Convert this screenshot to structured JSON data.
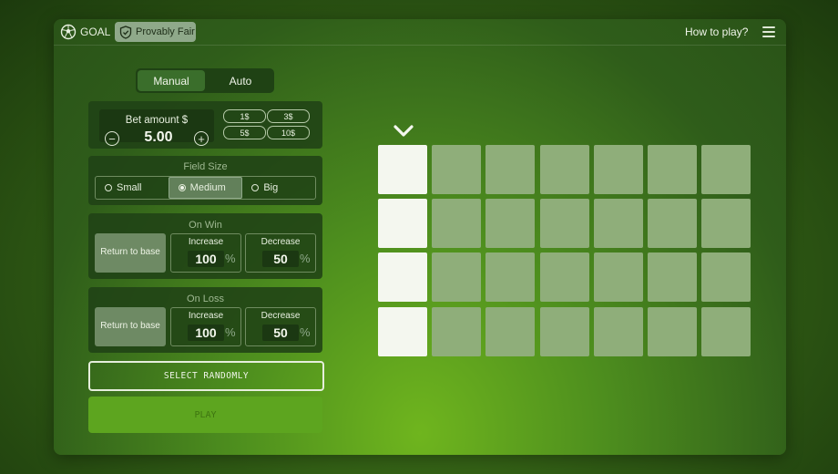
{
  "header": {
    "brand": "GOAL",
    "fair_label": "Provably Fair",
    "how_to_play": "How to play?"
  },
  "mode": {
    "tabs": [
      "Manual",
      "Auto"
    ],
    "active": "Manual"
  },
  "bet": {
    "label": "Bet amount $",
    "value": "5.00",
    "chips": [
      "1$",
      "3$",
      "5$",
      "10$"
    ]
  },
  "field_size": {
    "title": "Field Size",
    "options": [
      "Small",
      "Medium",
      "Big"
    ],
    "selected": "Medium"
  },
  "on_win": {
    "title": "On Win",
    "return_label": "Return to base",
    "increase_label": "Increase",
    "increase_value": "100",
    "decrease_label": "Decrease",
    "decrease_value": "50",
    "unit": "%"
  },
  "on_loss": {
    "title": "On Loss",
    "return_label": "Return to base",
    "increase_label": "Increase",
    "increase_value": "100",
    "decrease_label": "Decrease",
    "decrease_value": "50",
    "unit": "%"
  },
  "actions": {
    "select_randomly": "SELECT RANDOMLY",
    "play": "PLAY"
  },
  "board": {
    "rows": 4,
    "columns": 7,
    "active_column": 1
  },
  "colors": {
    "accent": "#5da51f",
    "cell_inactive": "#8fae7a",
    "cell_active": "#f4f7ef"
  }
}
